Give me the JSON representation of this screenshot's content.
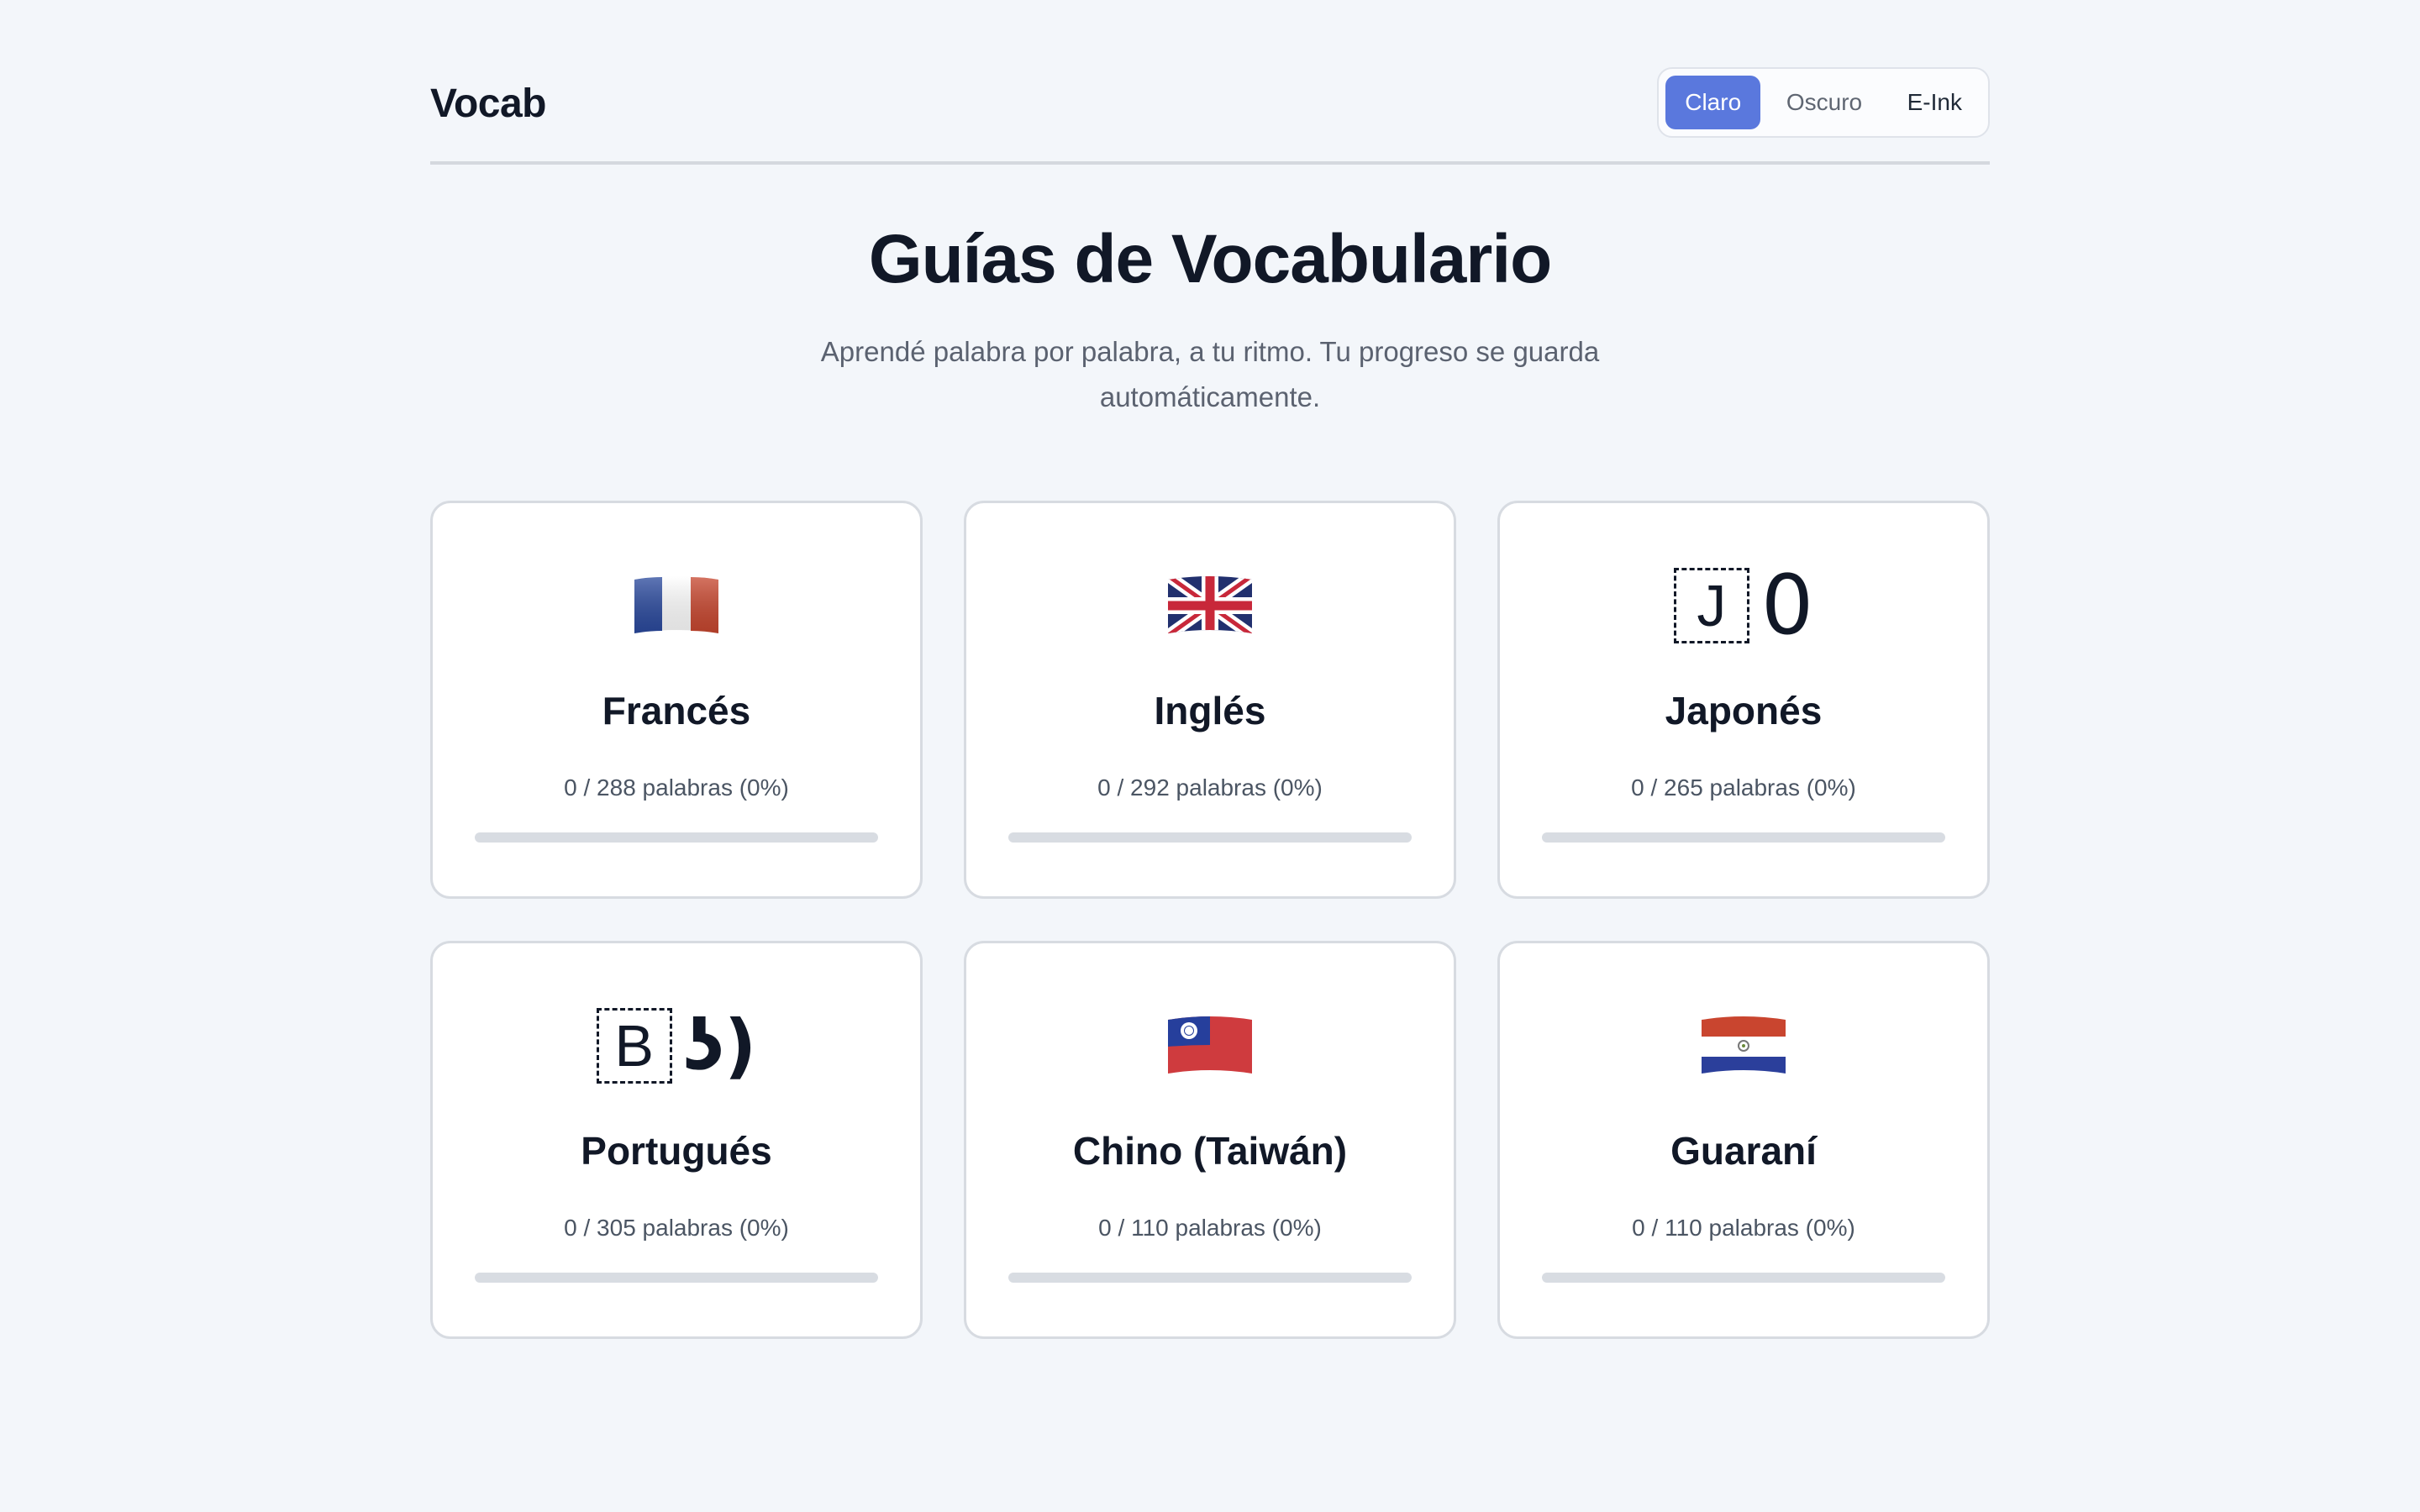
{
  "header": {
    "brand": "Vocab",
    "themes": [
      {
        "label": "Claro",
        "active": true
      },
      {
        "label": "Oscuro",
        "active": false
      },
      {
        "label": "E-Ink",
        "active": false
      }
    ]
  },
  "hero": {
    "title": "Guías de Vocabulario",
    "subtitle": "Aprendé palabra por palabra, a tu ritmo. Tu progreso se guarda automáticamente."
  },
  "guides": [
    {
      "name": "Francés",
      "count": "0 / 288 palabras (0%)",
      "progress": 0,
      "icon": "france-flag-icon"
    },
    {
      "name": "Inglés",
      "count": "0 / 292 palabras (0%)",
      "progress": 0,
      "icon": "uk-flag-icon"
    },
    {
      "name": "Japonés",
      "count": "0 / 265 palabras (0%)",
      "progress": 0,
      "icon": "missing-glyph-icon",
      "glyph_box": "J",
      "glyph_char": "0"
    },
    {
      "name": "Portugués",
      "count": "0 / 305 palabras (0%)",
      "progress": 0,
      "icon": "missing-glyph-icon",
      "glyph_box": "B",
      "glyph_char": "ʖ)"
    },
    {
      "name": "Chino (Taiwán)",
      "count": "0 / 110 palabras (0%)",
      "progress": 0,
      "icon": "taiwan-flag-icon"
    },
    {
      "name": "Guaraní",
      "count": "0 / 110 palabras (0%)",
      "progress": 0,
      "icon": "paraguay-flag-icon"
    }
  ],
  "colors": {
    "accent": "#5a78dd",
    "background": "#f3f6fa",
    "card_border": "#d7dbe1",
    "progress_track": "#d8dce2"
  }
}
